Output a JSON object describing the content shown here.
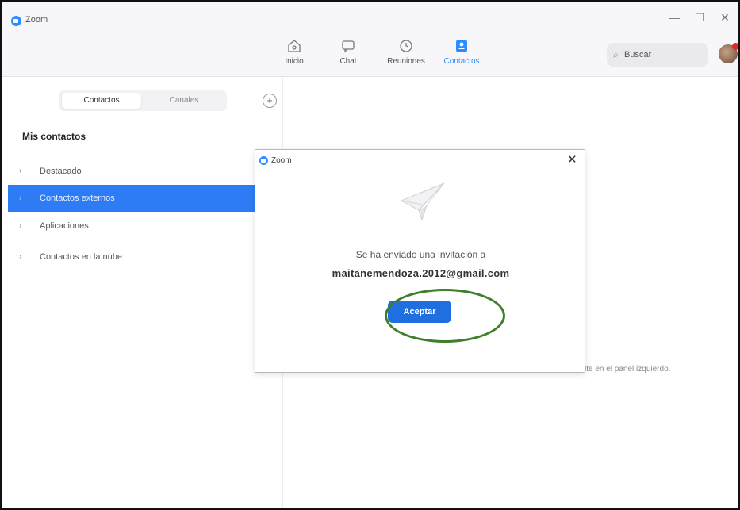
{
  "window": {
    "title": "Zoom",
    "controls": {
      "minimize": "—",
      "maximize": "☐",
      "close": "✕"
    }
  },
  "nav": {
    "items": [
      {
        "label": "Inicio",
        "icon": "home-icon"
      },
      {
        "label": "Chat",
        "icon": "chat-icon"
      },
      {
        "label": "Reuniones",
        "icon": "clock-icon"
      },
      {
        "label": "Contactos",
        "icon": "contacts-icon",
        "active": true
      }
    ],
    "search_placeholder": "Buscar",
    "accent_color": "#2d8cff"
  },
  "left_panel": {
    "tabs": [
      "Contactos",
      "Canales"
    ],
    "active_tab": "Contactos",
    "add_icon": "plus-circle-icon",
    "section_title": "Mis contactos",
    "items": [
      {
        "label": "Destacado"
      },
      {
        "label": "Contactos externos",
        "selected": true
      },
      {
        "label": "Aplicaciones"
      },
      {
        "label": "Contactos en la nube"
      }
    ]
  },
  "main": {
    "hint_fragment": "ite en el panel izquierdo."
  },
  "dialog": {
    "title": "Zoom",
    "message": "Se ha enviado una invitación a",
    "email": "maitanemendoza.2012@gmail.com",
    "button_label": "Aceptar",
    "icon": "paper-plane-icon"
  },
  "colors": {
    "selected_bg": "#2d7cf6",
    "button_bg": "#1f6fe0",
    "highlight_ring": "#3f7f2b"
  }
}
